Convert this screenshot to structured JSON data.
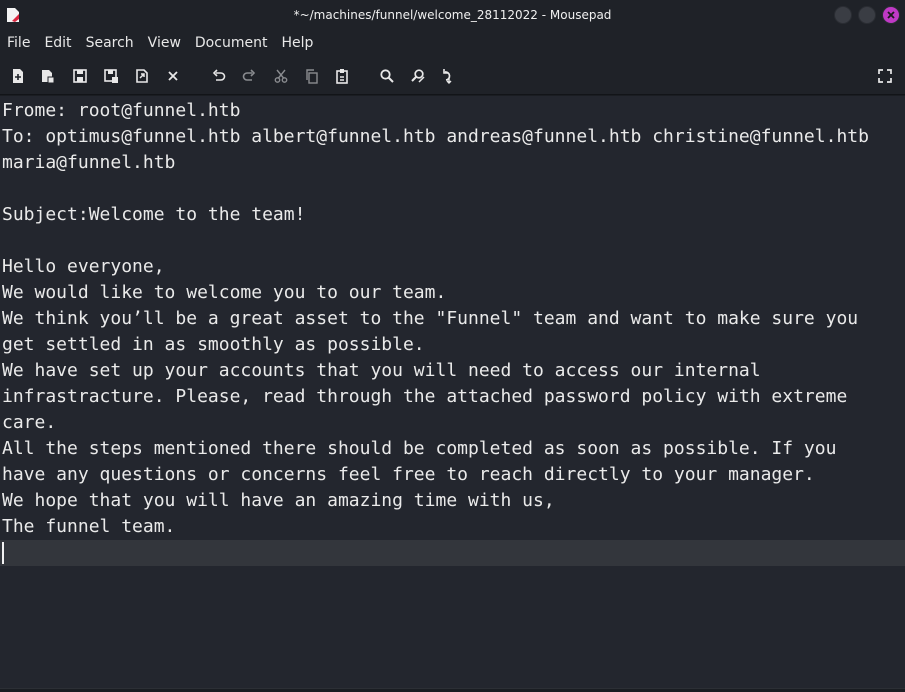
{
  "window": {
    "title": "*~/machines/funnel/welcome_28112022 - Mousepad",
    "buttons": [
      "minimize",
      "maximize",
      "close"
    ]
  },
  "menu": {
    "items": [
      "File",
      "Edit",
      "Search",
      "View",
      "Document",
      "Help"
    ]
  },
  "toolbar": {
    "icons": [
      "new-document-icon",
      "new-window-icon",
      "save-icon",
      "save-as-icon",
      "reload-icon",
      "close-tab-icon",
      "undo-icon",
      "redo-icon",
      "cut-icon",
      "copy-icon",
      "paste-icon",
      "find-icon",
      "find-replace-icon",
      "go-to-line-icon",
      "fullscreen-icon"
    ]
  },
  "document": {
    "lines": [
      "Frome: root@funnel.htb",
      "To: optimus@funnel.htb albert@funnel.htb andreas@funnel.htb christine@funnel.htb",
      "maria@funnel.htb",
      "",
      "Subject:Welcome to the team!",
      "",
      "Hello everyone,",
      "We would like to welcome you to our team.",
      "We think you’ll be a great asset to the \"Funnel\" team and want to make sure you",
      "get settled in as smoothly as possible.",
      "We have set up your accounts that you will need to access our internal",
      "infrastracture. Please, read through the attached password policy with extreme",
      "care.",
      "All the steps mentioned there should be completed as soon as possible. If you",
      "have any questions or concerns feel free to reach directly to your manager.",
      "We hope that you will have an amazing time with us,",
      "The funnel team.",
      ""
    ]
  },
  "colors": {
    "editor_bg": "#23262e",
    "chrome_bg": "#1f2228",
    "current_line": "#33363c",
    "close_button": "#c039c6"
  }
}
